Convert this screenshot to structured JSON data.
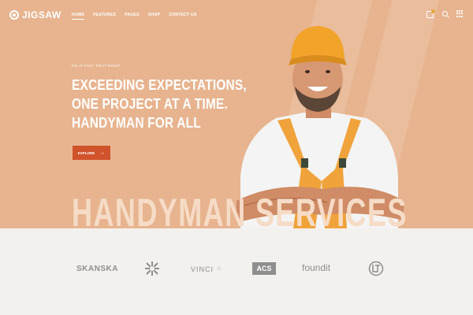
{
  "header": {
    "logo_text": "JIGSAW",
    "nav": [
      "HOME",
      "FEATURES",
      "PAGES",
      "SHOP",
      "CONTACT US"
    ],
    "icons": [
      "shopping-bag-icon",
      "search-icon",
      "grid-menu-icon"
    ]
  },
  "hero": {
    "eyebrow": "FIX IT FAST, FIX IT RIGHT",
    "headline": [
      "EXCEEDING EXPECTATIONS,",
      "ONE PROJECT AT A TIME.",
      "HANDYMAN FOR ALL"
    ],
    "cta_label": "EXPLORE",
    "big_title": "HANDYMAN SERVICES"
  },
  "partners": {
    "skanska": "SKANSKA",
    "vinci": "VINCI",
    "acs": "ACS",
    "foundit": "foundit"
  },
  "colors": {
    "hero_bg": "#e7b48f",
    "accent": "#d1532b",
    "page_bg": "#f3f1ed",
    "logo_gray": "#8e8e8e"
  }
}
